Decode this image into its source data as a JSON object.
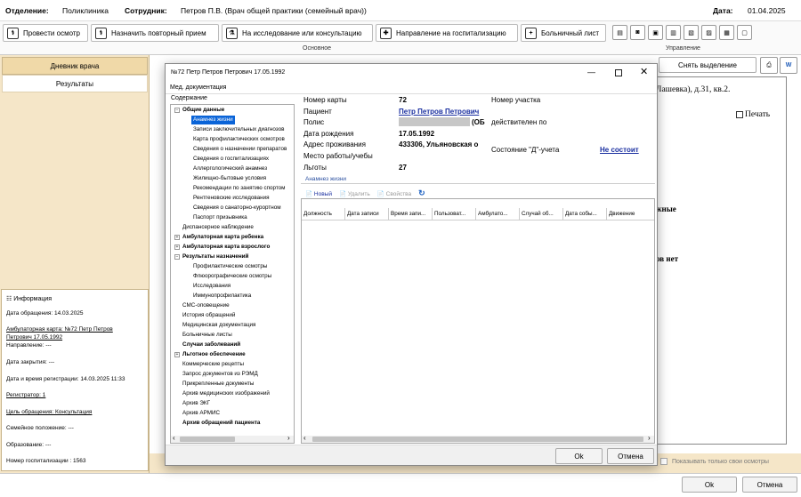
{
  "top": {
    "dept_label": "Отделение:",
    "dept_value": "Поликлиника",
    "staff_label": "Сотрудник:",
    "staff_value": "Петров П.В. (Врач общей практики (семейный врач))",
    "date_label": "Дата:",
    "date_value": "01.04.2025"
  },
  "ribbon": {
    "buttons": [
      "Провести осмотр",
      "Назначить повторный прием",
      "На исследование или консультацию",
      "Направление на госпитализацию",
      "Больничный лист"
    ],
    "group_main": "Основное",
    "group_manage": "Управление"
  },
  "left": {
    "tab1": "Дневник врача",
    "tab2": "Результаты",
    "info_title": "Информация",
    "info": [
      "Дата обращения: 14.03.2025",
      "Амбулаторная карта: №72 Петр Петров",
      "Петрович 17.05.1992",
      "Направление: ---",
      "Дата закрытия: ---",
      "Дата и время регистрации: 14.03.2025 11:33",
      "Регистратор: 1",
      "Цель обращения: Консультация",
      "Семейное положение: ---",
      "Образование: ---",
      "Номер госпитализации : 1563"
    ]
  },
  "doc": {
    "address_tail": "Лашевка), д.31, кв.2.",
    "print_label": "Печать",
    "frag1": "жные",
    "frag2": "ов нет",
    "deselect_button": "Снять выделение",
    "show_own_label": "Показывать только свои осмотры"
  },
  "modal": {
    "title": "№72 Петр Петров Петрович 17.05.1992",
    "menu": "Мед. документация",
    "contents_label": "Содержание",
    "tree": [
      "Общие данные",
      "Анамнез жизни",
      "Записи заключительных диагнозов",
      "Карта профилактических осмотров",
      "Сведения о назначении препаратов",
      "Сведения о госпитализациях",
      "Аллергологический анамнез",
      "Жилищно-бытовые условия",
      "Рекомендации по занятию спортом",
      "Рентгеновские исследования",
      "Сведения о санаторно-курортном",
      "Паспорт призывника",
      "Диспансерное наблюдение",
      "Амбулаторная карта ребенка",
      "Амбулаторная карта взрослого",
      "Результаты назначений",
      "Профилактические осмотры",
      "Флюорографические осмотры",
      "Исследования",
      "Иммунопрофилактика",
      "СМС-оповещение",
      "История обращений",
      "Медицинская документация",
      "Больничные листы",
      "Случаи заболеваний",
      "Льготное обеспечение",
      "Коммерческие рецепты",
      "Запрос документов из РЭМД",
      "Прикрепленные документы",
      "Архив медицинских изображений",
      "Архив ЭКГ",
      "Архив АРМИС",
      "Архив обращений пациента"
    ],
    "fields": {
      "card_no_label": "Номер карты",
      "card_no": "72",
      "patient_label": "Пациент",
      "patient": "Петр Петров Петрович",
      "policy_label": "Полис",
      "policy_tail": "(ОБ",
      "dob_label": "Дата рождения",
      "dob": "17.05.1992",
      "address_label": "Адрес проживания",
      "address": "433306, Ульяновская о",
      "work_label": "Место работы/учебы",
      "benefits_label": "Льготы",
      "benefits": "27",
      "district_label": "Номер участка",
      "valid_label": "действителен по",
      "d_state_label": "Состояние \"Д\"-учета",
      "d_state": "Не состоит"
    },
    "section_label": "Анамнез жизни",
    "toolbar": {
      "new": "Новый",
      "delete": "Удалить",
      "props": "Свойства"
    },
    "columns": [
      "Должность",
      "Дата записи",
      "Время запи...",
      "Пользоват...",
      "Амбулато...",
      "Случай об...",
      "Дата собы...",
      "Движение"
    ],
    "ok": "Ok",
    "cancel": "Отмена"
  },
  "bottom": {
    "ok": "Ok",
    "cancel": "Отмена"
  }
}
